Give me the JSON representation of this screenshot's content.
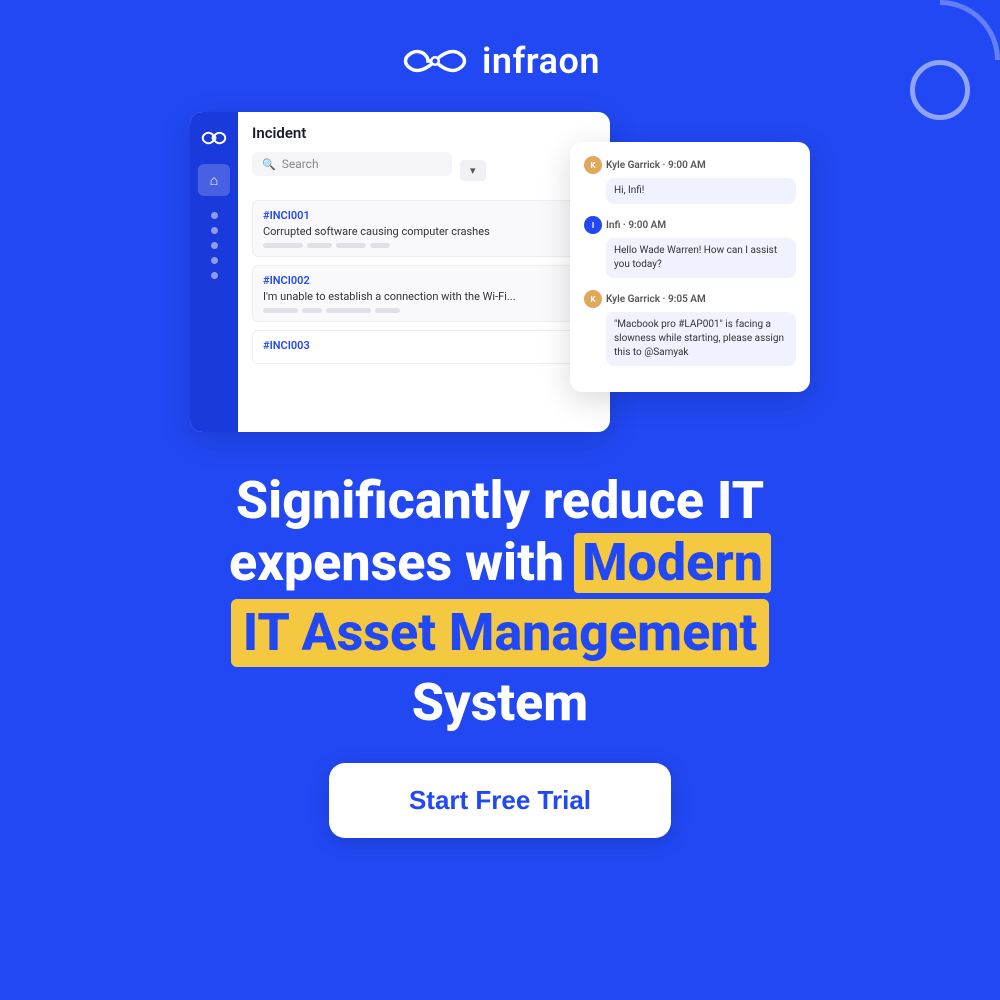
{
  "brand": {
    "name": "infraon",
    "logo_icon_alt": "infraon logo icon"
  },
  "decorative": {
    "circle": "○",
    "arc": ""
  },
  "incident_panel": {
    "title": "Incident",
    "search_placeholder": "Search",
    "items": [
      {
        "id": "#INCI001",
        "description": "Corrupted software causing computer crashes"
      },
      {
        "id": "#INCI002",
        "description": "I'm unable to establish a connection with the Wi-Fi..."
      },
      {
        "id": "#INCI003",
        "description": ""
      }
    ]
  },
  "chat_panel": {
    "messages": [
      {
        "sender": "Kyle Garrick",
        "time": "9:00 AM",
        "text": "Hi, Infi!",
        "avatar_initial": "K",
        "avatar_type": "kyle"
      },
      {
        "sender": "Infi",
        "time": "9:00 AM",
        "text": "Hello Wade Warren! How can I assist you today?",
        "avatar_initial": "I",
        "avatar_type": "infi"
      },
      {
        "sender": "Kyle Garrick",
        "time": "9:05 AM",
        "text": "\"Macbook pro #LAP001\" is facing a slowness while starting, please assign this to @Samyak",
        "avatar_initial": "K",
        "avatar_type": "kyle"
      }
    ]
  },
  "headline": {
    "line1": "Significantly reduce IT",
    "line2_prefix": "expenses with",
    "highlight": "Modern",
    "yellow_block": "IT Asset Management",
    "line3": "System"
  },
  "cta": {
    "label": "Start Free Trial"
  }
}
